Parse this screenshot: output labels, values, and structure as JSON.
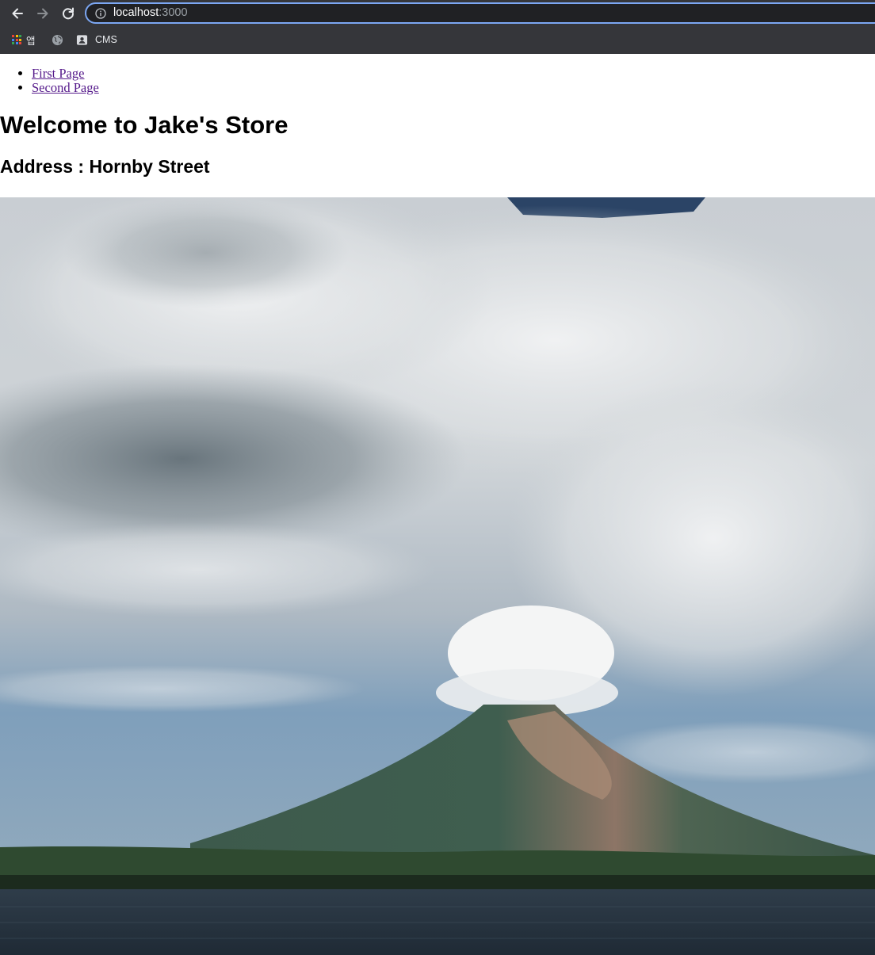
{
  "browser": {
    "url_host": "localhost",
    "url_port": ":3000",
    "bookmarks": [
      {
        "label": "앱",
        "icon": "apps-grid-icon"
      },
      {
        "label": "",
        "icon": "globe-icon"
      },
      {
        "label": "CMS",
        "icon": "contact-card-icon"
      }
    ]
  },
  "nav": {
    "links": [
      {
        "label": "First Page"
      },
      {
        "label": "Second Page"
      }
    ]
  },
  "heading": "Welcome to Jake's Store",
  "address": "Address : Hornby Street",
  "hero_image": {
    "subject": "volcano under clouds by a lake",
    "icon": "photo"
  },
  "colors": {
    "chrome_bg": "#35363a",
    "omnibox_border": "#7ca7f3",
    "visited_link": "#551a8b"
  }
}
